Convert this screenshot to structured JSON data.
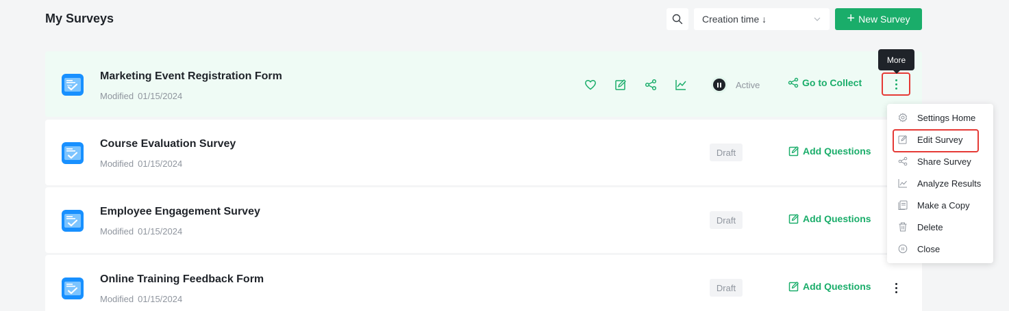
{
  "page_title": "My Surveys",
  "toolbar": {
    "search_icon": "search-icon",
    "sort_label": "Creation time ↓",
    "new_label": "New Survey"
  },
  "surveys": [
    {
      "title": "Marketing Event Registration Form",
      "modified_label": "Modified",
      "modified_date": "01/15/2024",
      "status": "Active",
      "action": "Go to Collect"
    },
    {
      "title": "Course Evaluation Survey",
      "modified_label": "Modified",
      "modified_date": "01/15/2024",
      "status": "Draft",
      "action": "Add Questions"
    },
    {
      "title": "Employee Engagement Survey",
      "modified_label": "Modified",
      "modified_date": "01/15/2024",
      "status": "Draft",
      "action": "Add Questions"
    },
    {
      "title": "Online Training Feedback Form",
      "modified_label": "Modified",
      "modified_date": "01/15/2024",
      "status": "Draft",
      "action": "Add Questions"
    }
  ],
  "tooltip": "More",
  "menu": [
    {
      "label": "Settings Home",
      "icon": "gear-icon"
    },
    {
      "label": "Edit Survey",
      "icon": "edit-icon"
    },
    {
      "label": "Share Survey",
      "icon": "share-icon"
    },
    {
      "label": "Analyze Results",
      "icon": "chart-icon"
    },
    {
      "label": "Make a Copy",
      "icon": "copy-icon"
    },
    {
      "label": "Delete",
      "icon": "trash-icon"
    },
    {
      "label": "Close",
      "icon": "pause-circle-icon"
    }
  ],
  "colors": {
    "accent": "#1aad6a",
    "highlight": "#e53935",
    "icon_blue": "#1890ff"
  }
}
